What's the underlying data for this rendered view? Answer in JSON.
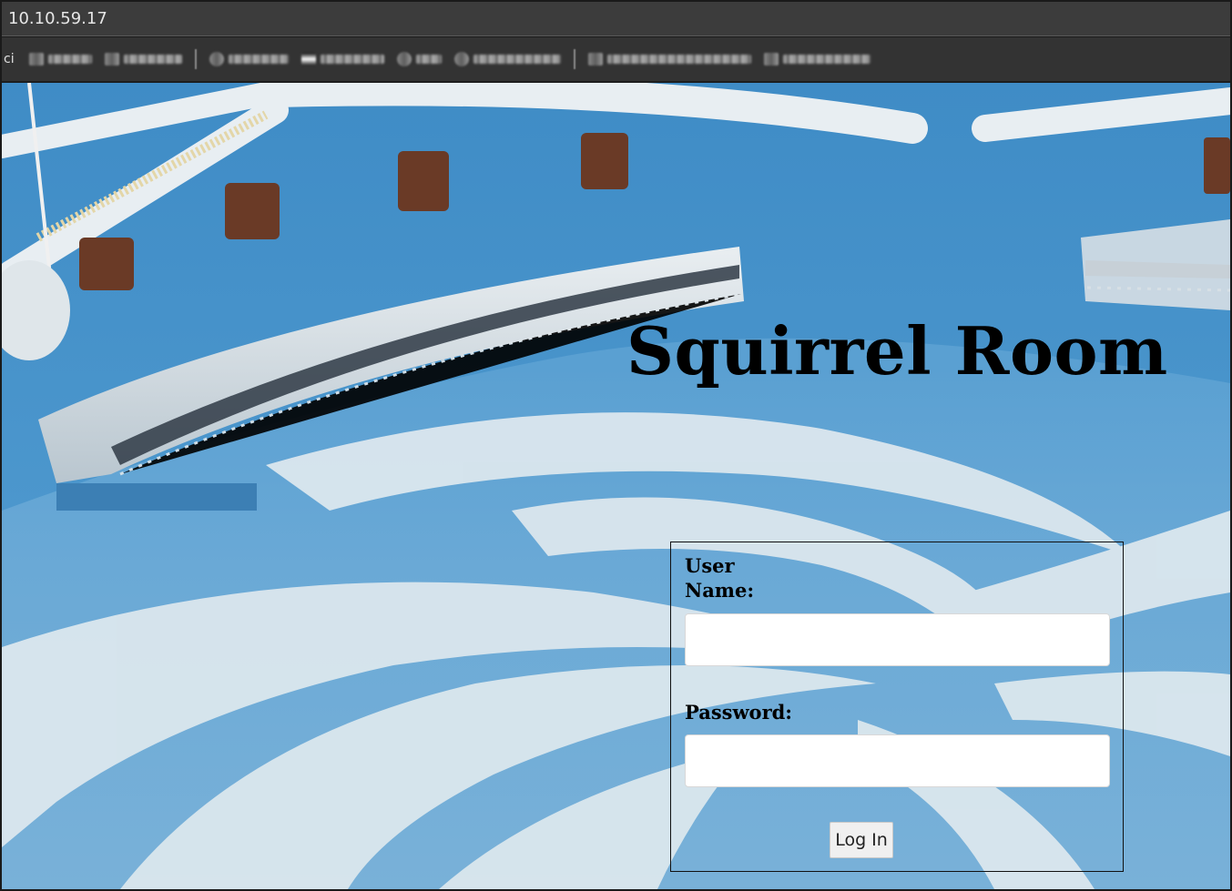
{
  "browser": {
    "address": "10.10.59.17"
  },
  "page": {
    "title": "Squirrel Room",
    "login": {
      "username_label": "User Name:",
      "password_label": "Password:",
      "username_value": "",
      "password_value": "",
      "submit_label": "Log In"
    }
  },
  "colors": {
    "title": "#000000",
    "background_blue": "#5aa0d2",
    "swirl_white": "#dfe9ef"
  }
}
